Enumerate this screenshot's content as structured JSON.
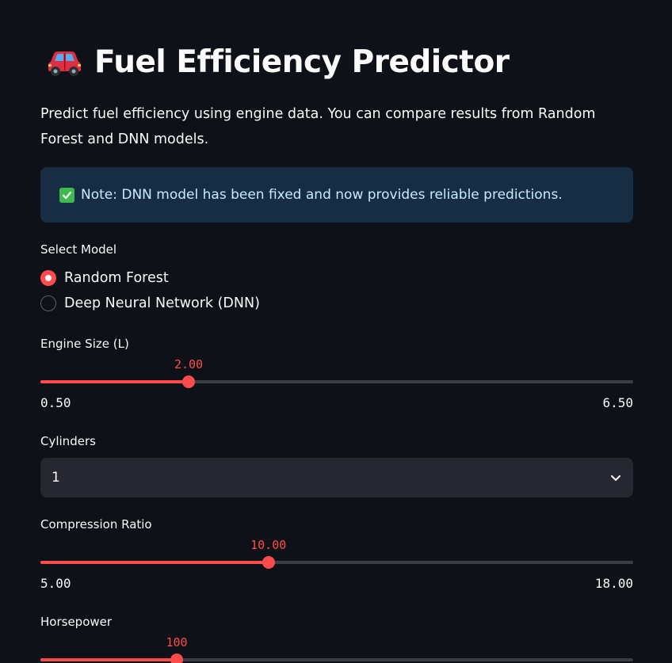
{
  "app": {
    "title": "Fuel Efficiency Predictor",
    "title_icon": "red-car-icon",
    "description": "Predict fuel efficiency using engine data. You can compare results from Random Forest and DNN models."
  },
  "alert": {
    "icon": "check-mark-icon",
    "text": "Note: DNN model has been fixed and now provides reliable predictions."
  },
  "model_select": {
    "label": "Select Model",
    "options": [
      "Random Forest",
      "Deep Neural Network (DNN)"
    ],
    "selected": "Random Forest"
  },
  "engine_size": {
    "label": "Engine Size (L)",
    "value": "2.00",
    "min": "0.50",
    "max": "6.50",
    "value_num": 2.0,
    "min_num": 0.5,
    "max_num": 6.5
  },
  "cylinders": {
    "label": "Cylinders",
    "value": "1",
    "icon": "chevron-down-icon"
  },
  "compression_ratio": {
    "label": "Compression Ratio",
    "value": "10.00",
    "min": "5.00",
    "max": "18.00",
    "value_num": 10.0,
    "min_num": 5.0,
    "max_num": 18.0
  },
  "horsepower": {
    "label": "Horsepower",
    "value": "100",
    "fill_fraction": 0.23
  },
  "colors": {
    "background": "#0e1117",
    "accent": "#ff4b4b",
    "alert_bg": "#172d43",
    "alert_text": "#c7ebff",
    "input_bg": "#262730"
  }
}
